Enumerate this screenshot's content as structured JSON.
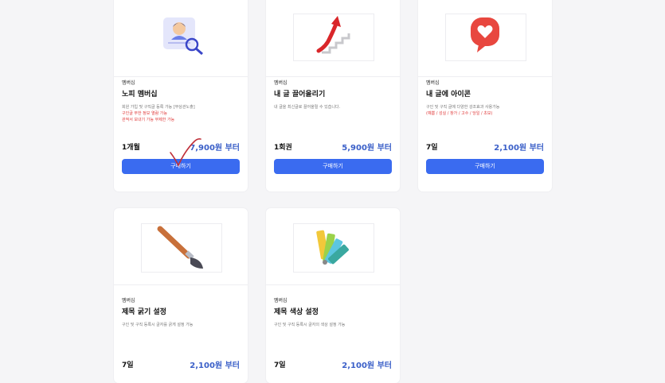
{
  "cards": [
    {
      "category": "멤버십",
      "title": "노피 멤버십",
      "desc": [
        "회원 가입 및 구직글 등록 가능 [무상관노출]",
        "구인글 무한 정보 열람 가능",
        "관적서 보내기 가능 무제한 가능"
      ],
      "desc_red": [
        false,
        true,
        true
      ],
      "duration": "1개월",
      "price": "7,900원 부터",
      "button": "구매하기",
      "icon": "profile-search-icon"
    },
    {
      "category": "멤버십",
      "title": "내 글 끌어올리기",
      "desc": [
        "내 글을 최신글로 끌어올릴 수 있습니다."
      ],
      "desc_red": [
        false
      ],
      "duration": "1회권",
      "price": "5,900원 부터",
      "button": "구매하기",
      "icon": "arrow-up-stairs-icon"
    },
    {
      "category": "멤버십",
      "title": "내 글에 아이콘",
      "desc": [
        "구인 및 구직 글에 다양한 강조효과 사용가능",
        "(예쁨 / 성실 / 창가 / 고수 / 당일 / 초보)"
      ],
      "desc_red": [
        false,
        true
      ],
      "duration": "7일",
      "price": "2,100원 부터",
      "button": "구매하기",
      "icon": "heart-bubble-icon"
    },
    {
      "category": "멤버십",
      "title": "제목 굵기 설정",
      "desc": [
        "구인 및 구직 등록시 글자를 굵게 설정 가능"
      ],
      "desc_red": [
        false
      ],
      "duration": "7일",
      "price": "2,100원 부터",
      "icon": "paintbrush-icon"
    },
    {
      "category": "멤버십",
      "title": "제목 색상 설정",
      "desc": [
        "구인 및 구직 등록시 글자의 색상 설정 가능"
      ],
      "desc_red": [
        false
      ],
      "duration": "7일",
      "price": "2,100원 부터",
      "icon": "color-palette-icon"
    }
  ],
  "colors": {
    "accent": "#3a6bf0",
    "price": "#3a5fc8",
    "warning": "#e03a3a",
    "check": "#c0303a"
  }
}
